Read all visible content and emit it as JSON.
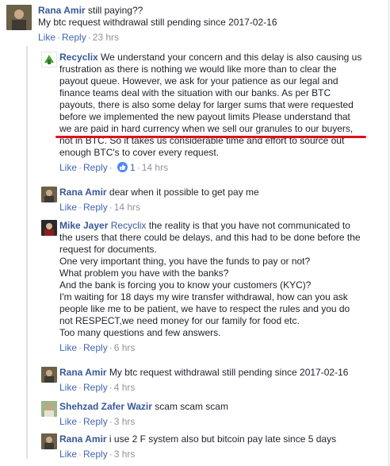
{
  "actions": {
    "like": "Like",
    "reply": "Reply",
    "separator": "·"
  },
  "comments": [
    {
      "author": "Rana Amir",
      "lines": [
        "still paying??",
        "My btc request withdrawal still pending since 2017-02-16"
      ],
      "time": "23 hrs"
    },
    {
      "author": "Recyclix",
      "lines": [
        "We understand your concern and this delay is also causing us",
        "frustration as there is nothing we would like more than to clear the",
        "payout queue. However, we ask for your patience as our legal and",
        "finance teams deal with the situation with our banks. As per BTC",
        "payouts, there is also some delay for larger sums that were requested",
        "before we implemented the new payout limits Please understand that",
        "we are paid in hard currency when we sell our granules to our buyers,",
        "not in BTC. So it takes us considerable time and effort to source out",
        "enough BTC's to cover every request."
      ],
      "reactions": "1",
      "time": "14 hrs"
    },
    {
      "author": "Rana Amir",
      "lines": [
        "dear when it possible to get pay me"
      ],
      "time": "14 hrs"
    },
    {
      "author": "Mike Jayer",
      "mention": "Recyclix",
      "lines": [
        "the reality is that you have not communicated to",
        "the users that there could be delays, and this had to be done before the",
        "request for documents.",
        "One very important thing, you have the funds to pay or not?",
        "What problem you have with the banks?",
        "And the bank is forcing you to know your customers (KYC)?",
        "I'm waiting for 18 days my wire transfer withdrawal, how can you ask",
        "people like me to be patient, we have to respect the rules and you do",
        "not RESPECT,we need money for our family for food etc.",
        "Too many questions and few answers."
      ],
      "time": "6 hrs"
    },
    {
      "author": "Rana Amir",
      "lines": [
        "My btc request withdrawal still pending since 2017-02-16"
      ],
      "time": "4 hrs"
    },
    {
      "author": "Shehzad Zafer Wazir",
      "lines": [
        "scam scam scam"
      ],
      "time": "3 hrs"
    },
    {
      "author": "Rana Amir",
      "lines": [
        "i use 2 F system also but bitcoin pay late since 5 days"
      ],
      "time": "3 hrs"
    }
  ]
}
